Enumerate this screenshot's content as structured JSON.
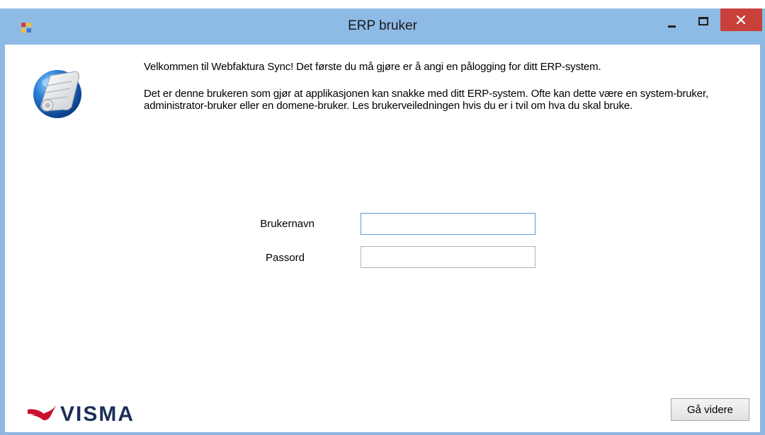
{
  "window": {
    "title": "ERP bruker"
  },
  "content": {
    "intro": "Velkommen til Webfaktura Sync! Det første du må gjøre er å angi en pålogging for ditt ERP-system.",
    "description": "Det er denne brukeren som gjør at applikasjonen kan snakke med ditt ERP-system. Ofte kan dette være en system-bruker, administrator-bruker eller en domene-bruker. Les brukerveiledningen hvis du er i tvil om hva du skal bruke."
  },
  "form": {
    "username_label": "Brukernavn",
    "username_value": "",
    "password_label": "Passord",
    "password_value": ""
  },
  "footer": {
    "brand": "VISMA",
    "next_label": "Gå videre"
  },
  "colors": {
    "titlebar": "#8ebae6",
    "close_button": "#c9403a",
    "brand_red": "#c8102e",
    "brand_navy": "#1c2e59",
    "focus_border": "#5f9ad8"
  },
  "icons": {
    "app": "app-icon",
    "minimize": "minimize-icon",
    "maximize": "maximize-icon",
    "close": "close-icon",
    "logo": "scroll-sphere-icon"
  }
}
